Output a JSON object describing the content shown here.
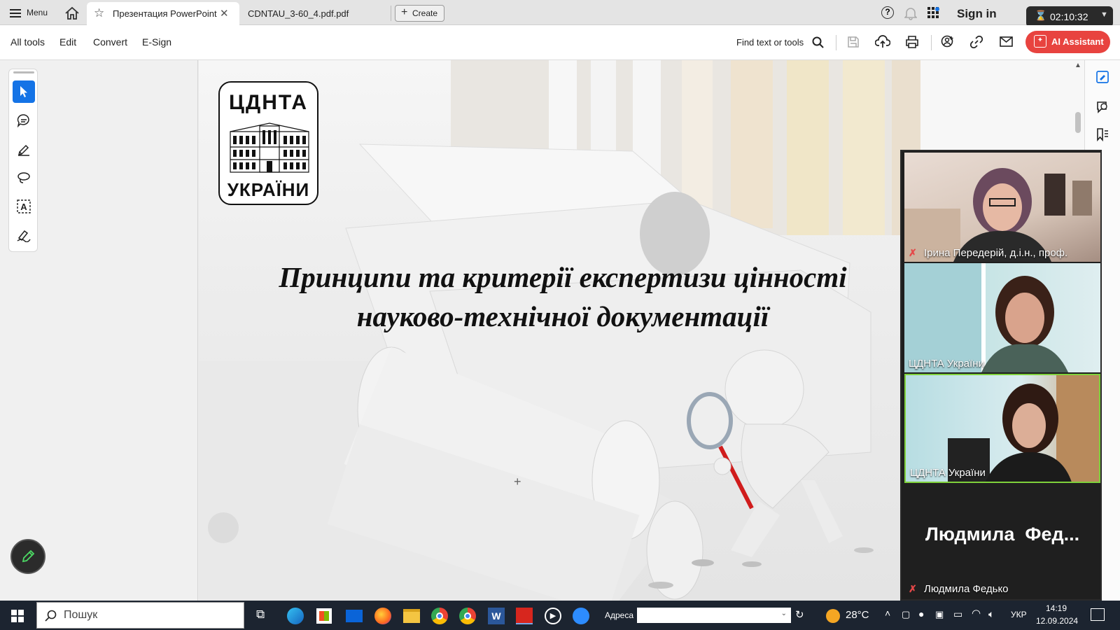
{
  "tabbar": {
    "menu_label": "Menu",
    "tabs": [
      {
        "label": "Презентация PowerPoint",
        "active": true
      },
      {
        "label": "CDNTAU_3-60_4.pdf.pdf",
        "active": false
      }
    ],
    "create_label": "Create",
    "sign_in": "Sign in",
    "timer": "02:10:32"
  },
  "toolbar": {
    "menu": [
      "All tools",
      "Edit",
      "Convert",
      "E-Sign"
    ],
    "find_label": "Find text or tools",
    "ai_label": "AI Assistant"
  },
  "slide": {
    "logo_top": "ЦДНТА",
    "logo_bottom": "УКРАЇНИ",
    "title_line1": "Принципи та критерії експертизи цінності",
    "title_line2": "науково-технічної документації"
  },
  "zoom": {
    "participants": [
      {
        "name": "Ірина Передерій, д.і.н., проф.",
        "muted": true
      },
      {
        "name": "ЦДНТА України",
        "muted": false
      },
      {
        "name": "ЦДНТА України",
        "muted": false,
        "speaking": true
      }
    ],
    "big_name": "Людмила  Фед...",
    "last_name": "Людмила Федько"
  },
  "taskbar": {
    "search_placeholder": "Пошук",
    "address_label": "Адреса",
    "weather": "28°C",
    "lang": "УКР",
    "time": "14:19",
    "date": "12.09.2024"
  },
  "colors": {
    "accent_blue": "#1473e6",
    "ai_button": "#e8433f",
    "speaking_border": "#7fd13b"
  }
}
